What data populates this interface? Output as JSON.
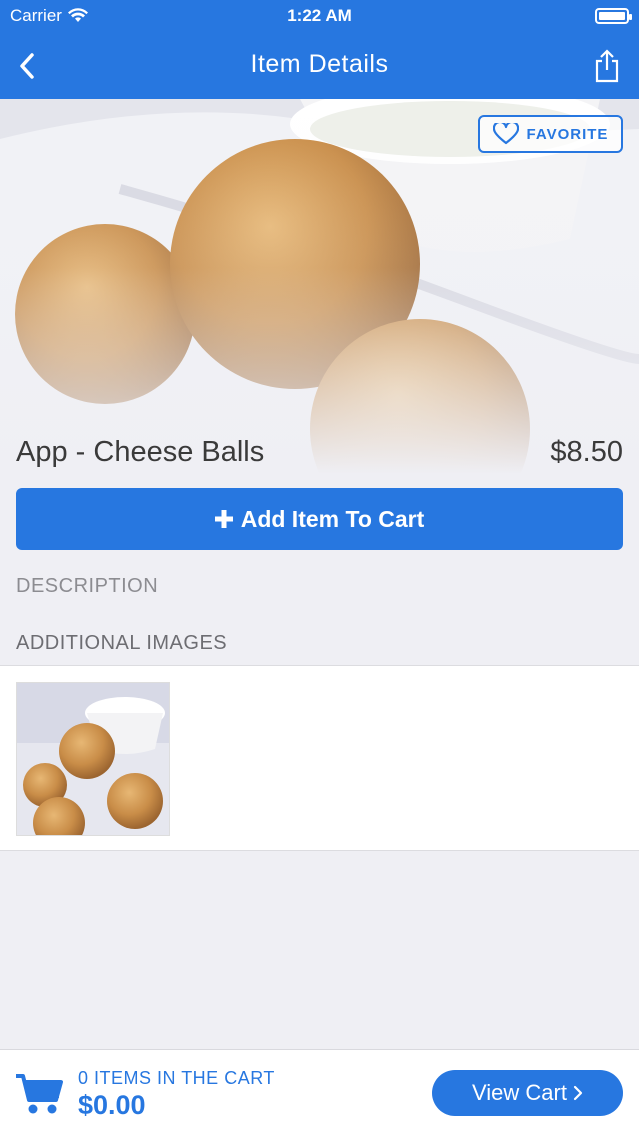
{
  "status_bar": {
    "carrier": "Carrier",
    "time": "1:22 AM"
  },
  "nav": {
    "title": "Item Details"
  },
  "item": {
    "favorite_label": "FAVORITE",
    "name": "App - Cheese Balls",
    "price": "$8.50",
    "add_to_cart_label": "Add Item To Cart"
  },
  "sections": {
    "description": "DESCRIPTION",
    "additional_images": "ADDITIONAL IMAGES"
  },
  "cart": {
    "count_label": "0 ITEMS IN THE CART",
    "total": "$0.00",
    "view_cart_label": "View Cart"
  },
  "colors": {
    "accent": "#2777e0",
    "background": "#efeff4"
  },
  "icons": [
    "back-chevron-icon",
    "share-icon",
    "wifi-icon",
    "battery-icon",
    "heart-icon",
    "plus-icon",
    "cart-icon",
    "chevron-right-icon"
  ]
}
